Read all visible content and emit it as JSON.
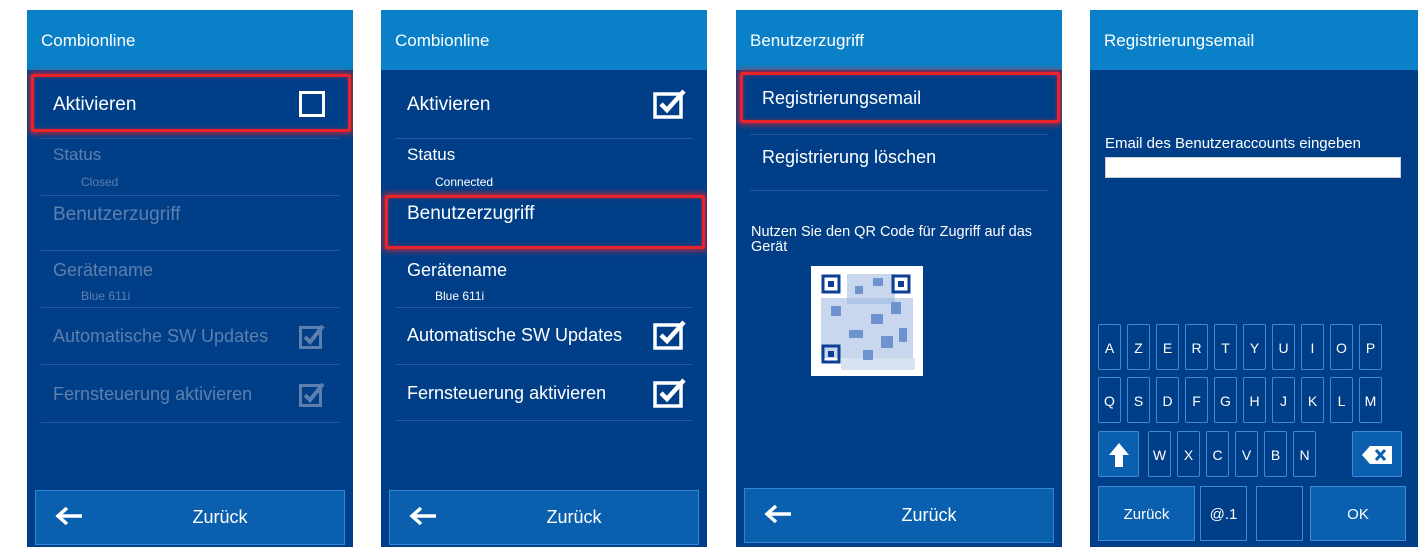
{
  "colors": {
    "panel": "#003f88",
    "titlebar": "#0a80c8",
    "highlight": "#e8232a",
    "button": "#0a5fae"
  },
  "screen1": {
    "title": "Combionline",
    "aktivieren": {
      "label": "Aktivieren",
      "checked": false
    },
    "status": {
      "label": "Status",
      "value": "Closed"
    },
    "benutzerzugriff": "Benutzerzugriff",
    "geraetename": {
      "label": "Gerätename",
      "value": "Blue 611i"
    },
    "auto_updates": {
      "label": "Automatische SW Updates",
      "checked": true
    },
    "fernsteuerung": {
      "label": "Fernsteuerung aktivieren",
      "checked": true
    },
    "back": "Zurück"
  },
  "screen2": {
    "title": "Combionline",
    "aktivieren": {
      "label": "Aktivieren",
      "checked": true
    },
    "status": {
      "label": "Status",
      "value": "Connected"
    },
    "benutzerzugriff": "Benutzerzugriff",
    "geraetename": {
      "label": "Gerätename",
      "value": "Blue 611i"
    },
    "auto_updates": {
      "label": "Automatische SW Updates",
      "checked": true
    },
    "fernsteuerung": {
      "label": "Fernsteuerung aktivieren",
      "checked": true
    },
    "back": "Zurück"
  },
  "screen3": {
    "title": "Benutzerzugriff",
    "registrierungsemail": "Registrierungsemail",
    "registrierung_loeschen": "Registrierung löschen",
    "qr_hint": "Nutzen Sie den QR Code für Zugriff auf das Gerät",
    "back": "Zurück"
  },
  "screen4": {
    "title": "Registrierungsemail",
    "email_label": "Email des Benutzeraccounts eingeben",
    "email_value": "",
    "keyboard": {
      "row1": [
        "A",
        "Z",
        "E",
        "R",
        "T",
        "Y",
        "U",
        "I",
        "O",
        "P"
      ],
      "row2": [
        "Q",
        "S",
        "D",
        "F",
        "G",
        "H",
        "J",
        "K",
        "L",
        "M"
      ],
      "row3": [
        "W",
        "X",
        "C",
        "V",
        "B",
        "N"
      ],
      "back": "Zurück",
      "symbols": "@.1",
      "ok": "OK"
    },
    "icons": {
      "shift": "shift-up-icon",
      "backspace": "backspace-icon"
    }
  }
}
